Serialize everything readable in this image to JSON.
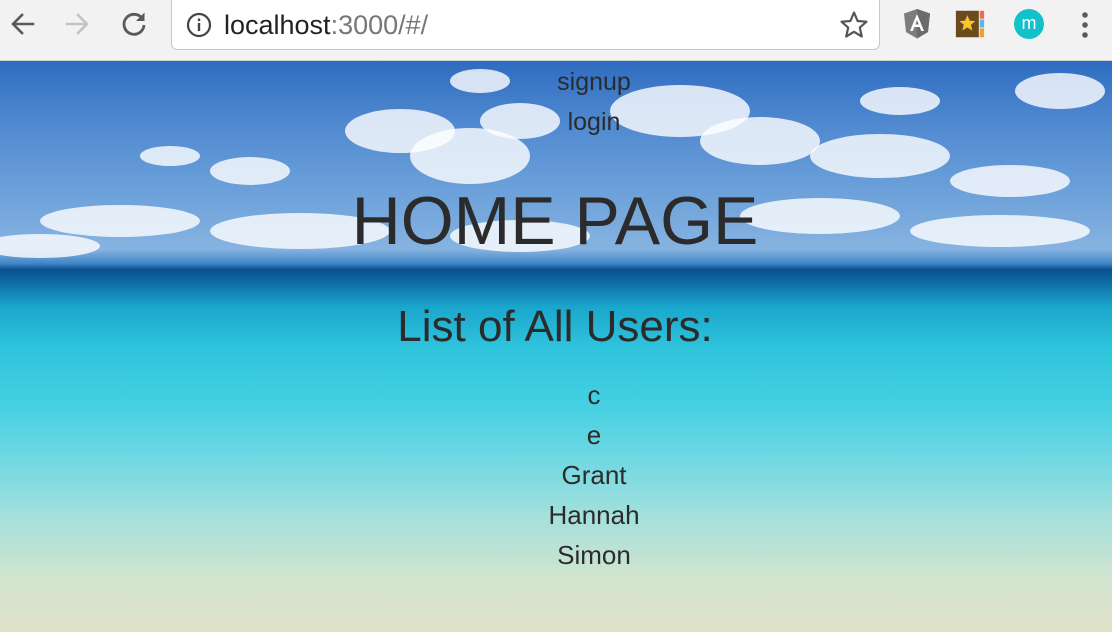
{
  "browser": {
    "url_host": "localhost",
    "url_path": ":3000/#/",
    "extensions": [
      "angular-icon",
      "bookmark-star-icon",
      "m-extension-icon"
    ],
    "ext_m_letter": "m",
    "colors": {
      "toolbar_bg": "#f2f2f2",
      "ext_m_bg": "#12c1c9"
    }
  },
  "page": {
    "nav": {
      "signup": "signup",
      "login": "login"
    },
    "title": "HOME PAGE",
    "users_heading": "List of All Users:",
    "users": [
      "c",
      "e",
      "Grant",
      "Hannah",
      "Simon"
    ],
    "background": "beach-ocean-sky"
  }
}
